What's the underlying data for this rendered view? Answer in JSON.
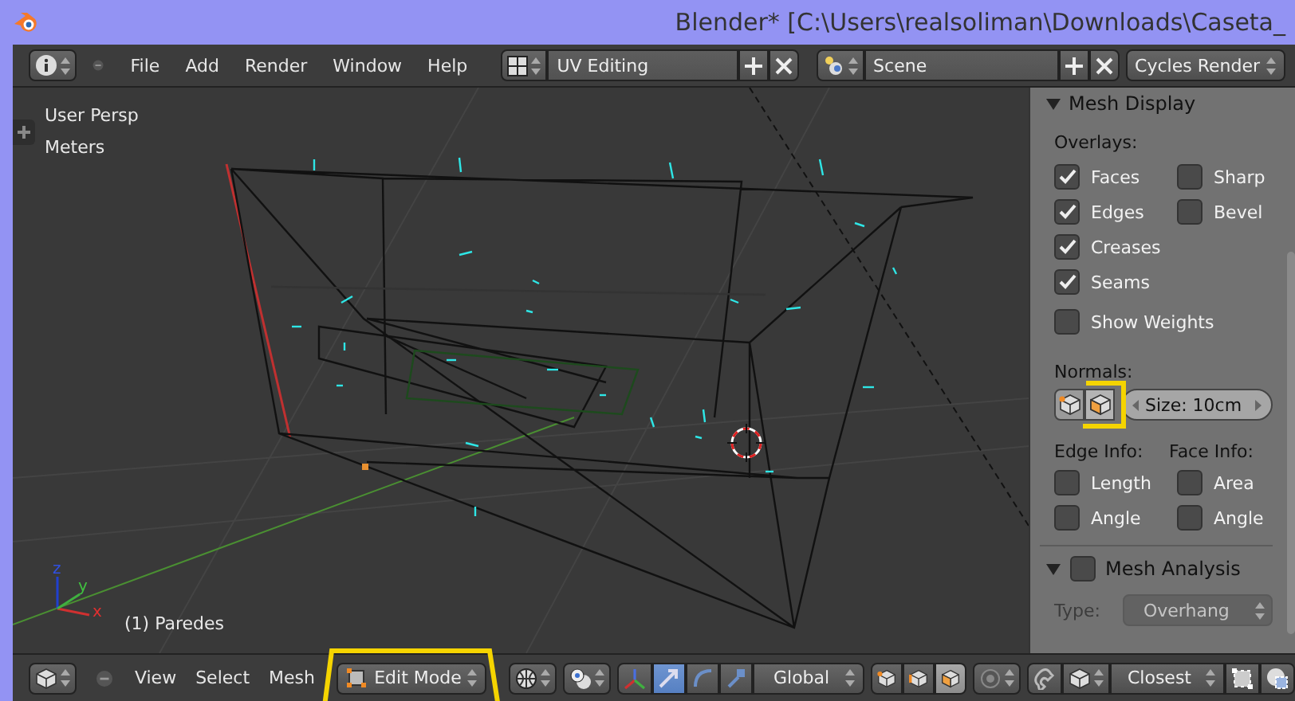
{
  "title_bar": {
    "title": "Blender* [C:\\Users\\realsoliman\\Downloads\\Caseta_"
  },
  "top_header": {
    "menus": [
      "File",
      "Add",
      "Render",
      "Window",
      "Help"
    ],
    "layout": "UV Editing",
    "scene": "Scene",
    "engine": "Cycles Render"
  },
  "viewport": {
    "view_name": "User Persp",
    "units": "Meters",
    "axis_labels": [
      "z",
      "y",
      "x"
    ],
    "object_label": "(1) Paredes"
  },
  "properties": {
    "panel_title": "Mesh Display",
    "expanded": true,
    "overlays_label": "Overlays:",
    "overlay_columns": [
      {
        "items": [
          {
            "label": "Faces",
            "checked": true
          },
          {
            "label": "Edges",
            "checked": true
          },
          {
            "label": "Creases",
            "checked": true
          },
          {
            "label": "Seams",
            "checked": true
          }
        ]
      },
      {
        "items": [
          {
            "label": "Sharp",
            "checked": false
          },
          {
            "label": "Bevel",
            "checked": false
          }
        ]
      }
    ],
    "show_weights": {
      "label": "Show Weights",
      "checked": false
    },
    "normals_label": "Normals:",
    "normals_buttons": [
      {
        "kind": "vertex",
        "selected": false
      },
      {
        "kind": "face",
        "selected": true
      }
    ],
    "normals_size": "Size: 10cm",
    "edge_info_label": "Edge Info:",
    "face_info_label": "Face Info:",
    "edge_info": [
      {
        "label": "Length",
        "checked": false
      },
      {
        "label": "Angle",
        "checked": false
      }
    ],
    "face_info": [
      {
        "label": "Area",
        "checked": false
      },
      {
        "label": "Angle",
        "checked": false
      }
    ],
    "analysis": {
      "title": "Mesh Analysis",
      "checked": false,
      "expanded": true,
      "type_label": "Type:",
      "type_value": "Overhang",
      "disabled": true
    }
  },
  "bottom_header": {
    "menus": [
      "View",
      "Select",
      "Mesh"
    ],
    "mode": "Edit Mode",
    "manipulators": [
      {
        "kind": "translate",
        "selected": true
      },
      {
        "kind": "rotate",
        "selected": false
      },
      {
        "kind": "scale",
        "selected": false
      }
    ],
    "orientation": "Global",
    "select_modes": [
      {
        "kind": "vertex",
        "selected": false
      },
      {
        "kind": "edge",
        "selected": false
      },
      {
        "kind": "face",
        "selected": true
      }
    ],
    "snap_target": "Closest"
  }
}
